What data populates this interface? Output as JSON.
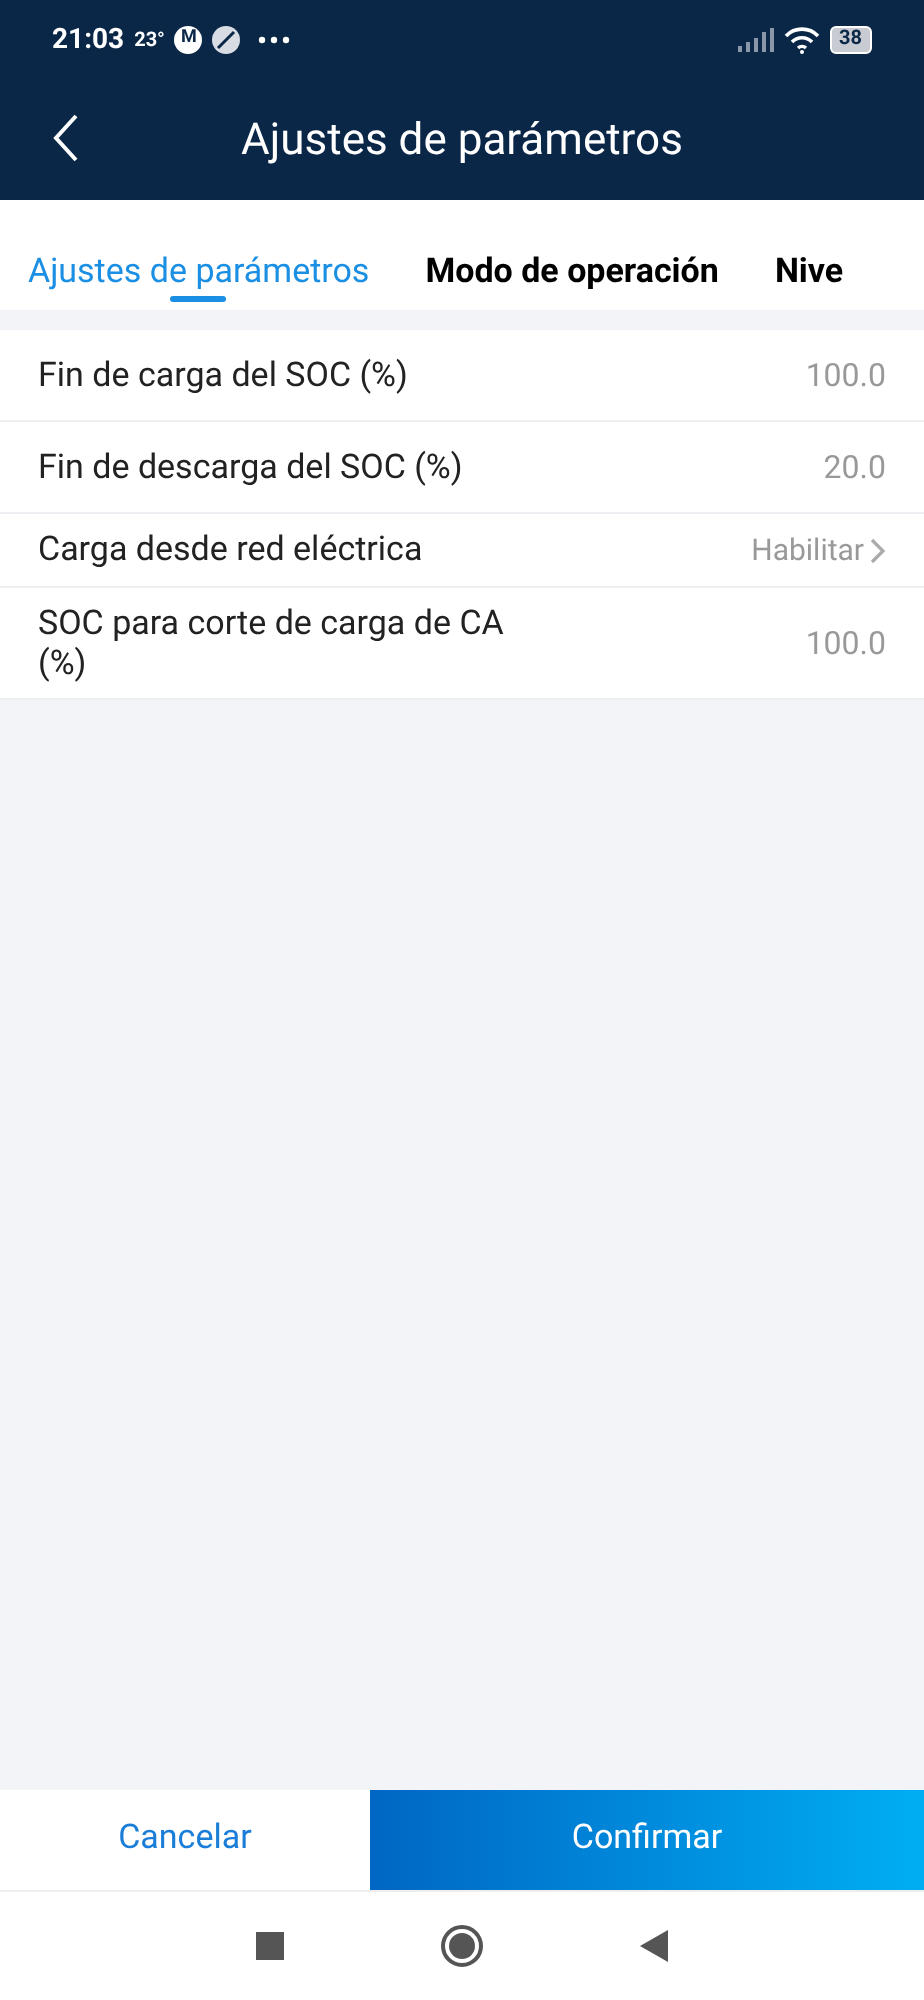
{
  "status_bar": {
    "time": "21:03",
    "temperature": "23°",
    "badge": "M",
    "battery": "38"
  },
  "header": {
    "title": "Ajustes de parámetros"
  },
  "tabs": [
    {
      "label": "Ajustes de parámetros",
      "selected": true
    },
    {
      "label": "Modo de operación",
      "selected": false
    },
    {
      "label": "Nive",
      "selected": false
    }
  ],
  "settings": [
    {
      "kind": "value",
      "label": "Fin de carga del SOC (%)",
      "value": "100.0"
    },
    {
      "kind": "value",
      "label": "Fin de descarga del SOC (%)",
      "value": "20.0"
    },
    {
      "kind": "link",
      "label": "Carga desde red eléctrica",
      "value": "Habilitar"
    },
    {
      "kind": "value",
      "label": "SOC para corte de carga de CA (%)",
      "value": "100.0"
    }
  ],
  "buttons": {
    "cancel": "Cancelar",
    "confirm": "Confirmar"
  }
}
